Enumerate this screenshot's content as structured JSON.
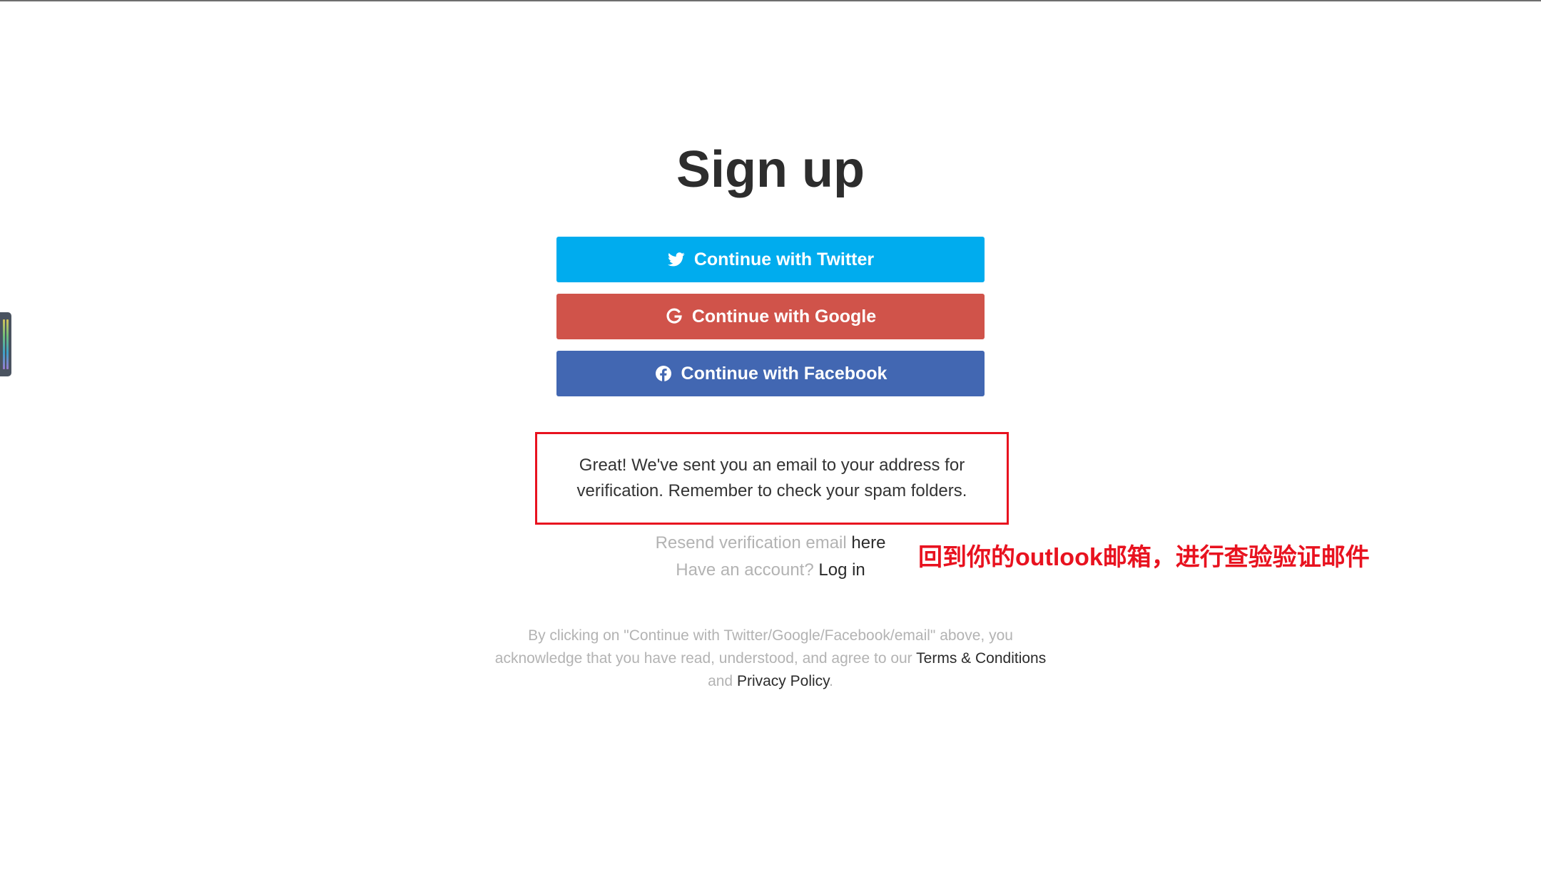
{
  "page": {
    "title": "Sign up"
  },
  "buttons": {
    "twitter": "Continue with Twitter",
    "google": "Continue with Google",
    "facebook": "Continue with Facebook"
  },
  "notice": {
    "line1": "Great! We've sent you an email to your address for",
    "line2": "verification. Remember to check your spam folders."
  },
  "resend": {
    "text": "Resend verification email",
    "link": "here"
  },
  "login": {
    "text": "Have an account?",
    "link": "Log in"
  },
  "annotation": {
    "text": "回到你的outlook邮箱，进行查验验证邮件"
  },
  "legal": {
    "line1": "By clicking on \"Continue with Twitter/Google/Facebook/email\" above, you",
    "line2": "acknowledge that you have read, understood, and agree to our",
    "terms": "Terms & Conditions",
    "and": "and",
    "privacy": "Privacy Policy",
    "period": "."
  },
  "icons": {
    "twitter": "twitter-icon",
    "google": "google-icon",
    "facebook": "facebook-icon",
    "side_panel": "equalizer-icon"
  },
  "colors": {
    "twitter": "#00acee",
    "google": "#d0534a",
    "facebook": "#4267b2",
    "annotation": "#e8121f"
  }
}
